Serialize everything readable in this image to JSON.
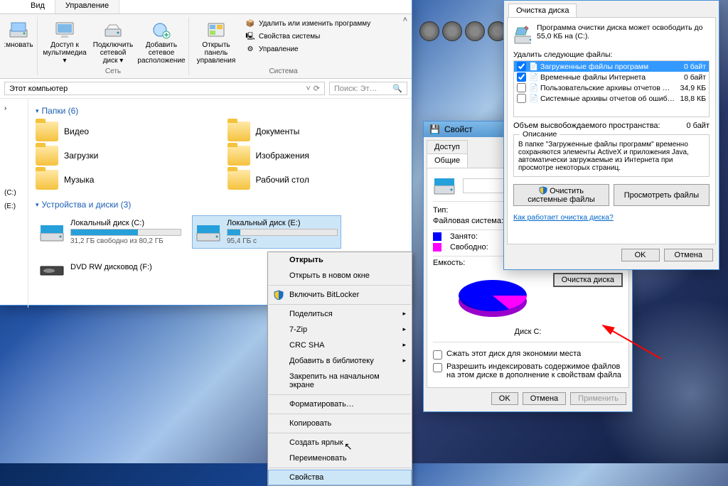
{
  "explorer": {
    "tabs": {
      "view": "Вид",
      "manage": "Управление"
    },
    "ribbon": {
      "remap": ":мновать",
      "multimedia": "Доступ к мультимедиа ▾",
      "netdrive": "Подключить сетевой диск ▾",
      "netloc": "Добавить сетевое расположение",
      "network_group": "Сеть",
      "ctrlpanel": "Открыть панель управления",
      "uninstall": "Удалить или изменить программу",
      "sysprops": "Свойства системы",
      "manage": "Управление",
      "system_group": "Система"
    },
    "address": "Этот компьютер",
    "search_placeholder": "Поиск: Эт…",
    "nav_refresh": "⟳",
    "sidebar": {
      "c": "(C:)",
      "e": "(E:)"
    },
    "folders_header": "Папки (6)",
    "folders": [
      {
        "name": "Видео"
      },
      {
        "name": "Документы"
      },
      {
        "name": "Загрузки"
      },
      {
        "name": "Изображения"
      },
      {
        "name": "Музыка"
      },
      {
        "name": "Рабочий стол"
      }
    ],
    "drives_header": "Устройства и диски (3)",
    "drives": [
      {
        "name": "Локальный диск (C:)",
        "sub": "31,2 ГБ свободно из 80,2 ГБ",
        "fill": 61
      },
      {
        "name": "Локальный диск (E:)",
        "sub": "95,4 ГБ с",
        "fill": 12
      },
      {
        "name": "DVD RW дисковод (F:)",
        "sub": "",
        "fill": -1
      }
    ]
  },
  "context_menu": {
    "open": "Открыть",
    "open_new": "Открыть в новом окне",
    "bitlocker": "Включить BitLocker",
    "share": "Поделиться",
    "sevenzip": "7-Zip",
    "crcsha": "CRC SHA",
    "add_lib": "Добавить в библиотеку",
    "pin_start": "Закрепить на начальном экране",
    "format": "Форматировать…",
    "copy": "Копировать",
    "shortcut": "Создать ярлык",
    "rename": "Переименовать",
    "properties": "Свойства"
  },
  "props": {
    "title": "Свойст",
    "tab_access": "Доступ",
    "tab_general": "Общие",
    "type": "Тип:",
    "fs": "Файловая система:",
    "used": "Занято:",
    "free": "Свободно:",
    "capacity": "Емкость:",
    "disk_label": "Диск C:",
    "cleanup_btn": "Очистка диска",
    "compress": "Сжать этот диск для экономии места",
    "index": "Разрешить индексировать содержимое файлов на этом диске в дополнение к свойствам файла",
    "ok": "OK",
    "cancel": "Отмена",
    "apply": "Применить"
  },
  "cleanup": {
    "tab": "Очистка диска",
    "info": "Программа очистки диска может освободить до 55,0 КБ на (C:).",
    "delete_label": "Удалить следующие файлы:",
    "items": [
      {
        "n": "Загруженные файлы программ",
        "s": "0 байт",
        "c": true
      },
      {
        "n": "Временные файлы Интернета",
        "s": "0 байт",
        "c": true
      },
      {
        "n": "Пользовательские архивы отчетов …",
        "s": "34,9 КБ",
        "c": false
      },
      {
        "n": "Системные архивы отчетов об ошиб…",
        "s": "18,8 КБ",
        "c": false
      }
    ],
    "freed_label": "Объем высвобождаемого пространства:",
    "freed_value": "0 байт",
    "desc_header": "Описание",
    "desc": "В папке \"Загруженные файлы программ\" временно сохраняются элементы ActiveX и приложения Java, автоматически загружаемые из Интернета при просмотре некоторых страниц.",
    "clean_sys": "Очистить системные файлы",
    "view_files": "Просмотреть файлы",
    "how_link": "Как работает очистка диска?",
    "ok": "OK",
    "cancel": "Отмена"
  },
  "chart_data": {
    "type": "pie",
    "title": "Диск C:",
    "series": [
      {
        "name": "Занято",
        "color": "#0000ff",
        "value": 61
      },
      {
        "name": "Свободно",
        "color": "#ff00ff",
        "value": 39
      }
    ]
  }
}
